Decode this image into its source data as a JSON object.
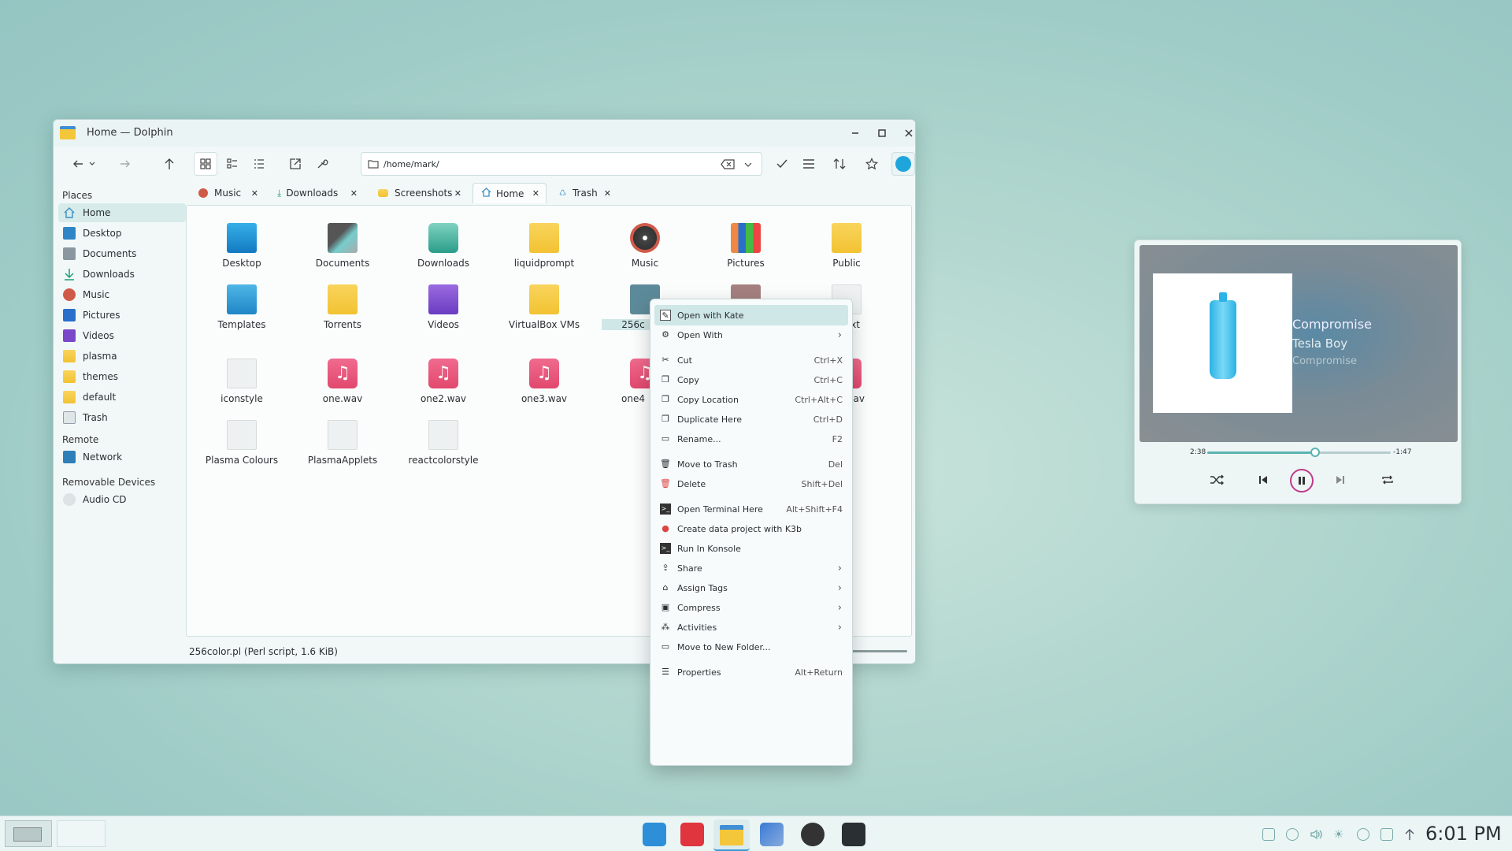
{
  "window": {
    "title": "Home — Dolphin",
    "path": "/home/mark/"
  },
  "places": {
    "header": "Places",
    "items": [
      "Home",
      "Desktop",
      "Documents",
      "Downloads",
      "Music",
      "Pictures",
      "Videos",
      "plasma",
      "themes",
      "default",
      "Trash"
    ],
    "remote_header": "Remote",
    "remote": [
      "Network"
    ],
    "removable_header": "Removable Devices",
    "removable": [
      "Audio CD"
    ]
  },
  "tabs": [
    "Music",
    "Downloads",
    "Screenshots",
    "Home",
    "Trash"
  ],
  "files": [
    "Desktop",
    "Documents",
    "Downloads",
    "liquidprompt",
    "Music",
    "Pictures",
    "Public",
    "Templates",
    "Torrents",
    "Videos",
    "VirtualBox VMs",
    "256c",
    "iconstyle",
    "one.wav",
    "one2.wav",
    "one3.wav",
    "one4",
    "Plasma Colours",
    "PlasmaApplets",
    "reactcolorstyle"
  ],
  "partial_labels": {
    "txt": ".txt",
    "wav": "wav"
  },
  "status": "256color.pl (Perl script, 1.6 KiB)",
  "context_menu": [
    {
      "label": "Open with Kate",
      "shortcut": ""
    },
    {
      "label": "Open With",
      "shortcut": ""
    },
    {
      "label": "Cut",
      "shortcut": "Ctrl+X"
    },
    {
      "label": "Copy",
      "shortcut": "Ctrl+C"
    },
    {
      "label": "Copy Location",
      "shortcut": "Ctrl+Alt+C"
    },
    {
      "label": "Duplicate Here",
      "shortcut": "Ctrl+D"
    },
    {
      "label": "Rename...",
      "shortcut": "F2"
    },
    {
      "label": "Move to Trash",
      "shortcut": "Del"
    },
    {
      "label": "Delete",
      "shortcut": "Shift+Del"
    },
    {
      "label": "Open Terminal Here",
      "shortcut": "Alt+Shift+F4"
    },
    {
      "label": "Create data project with K3b",
      "shortcut": ""
    },
    {
      "label": "Run In Konsole",
      "shortcut": ""
    },
    {
      "label": "Share",
      "shortcut": ""
    },
    {
      "label": "Assign Tags",
      "shortcut": ""
    },
    {
      "label": "Compress",
      "shortcut": ""
    },
    {
      "label": "Activities",
      "shortcut": ""
    },
    {
      "label": "Move to New Folder...",
      "shortcut": ""
    },
    {
      "label": "Properties",
      "shortcut": "Alt+Return"
    }
  ],
  "player": {
    "title": "Compromise",
    "artist": "Tesla Boy",
    "album": "Compromise",
    "elapsed": "2:38",
    "remaining": "-1:47",
    "progress": 0.59
  },
  "clock": "6:01 PM"
}
